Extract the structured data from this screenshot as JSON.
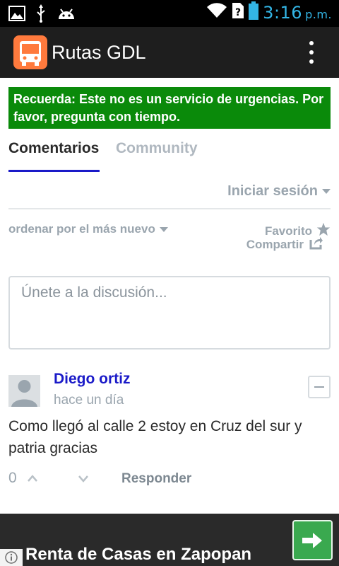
{
  "status_bar": {
    "time": "3:16",
    "ampm": "p.m.",
    "left_icons": [
      "gallery-icon",
      "usb-icon",
      "android-icon"
    ],
    "right_icons": [
      "wifi-icon",
      "sim-unknown-icon",
      "battery-icon"
    ],
    "time_color": "#33b5e5"
  },
  "action_bar": {
    "app_icon": "bus-icon",
    "title": "Rutas GDL",
    "overflow_icon": "overflow-menu-icon"
  },
  "banner": {
    "text": "Recuerda: Este no es un servicio de urgencias. Por favor, pregunta con tiempo.",
    "background": "#0a8a0a"
  },
  "tabs": [
    {
      "label": "Comentarios",
      "active": true
    },
    {
      "label": "Community",
      "active": false
    }
  ],
  "account": {
    "login_label": "Iniciar sesión"
  },
  "toolbar": {
    "sort_label": "ordenar por el más nuevo",
    "favorite_label": "Favorito",
    "share_label": "Compartir"
  },
  "composer": {
    "placeholder": "Únete a la discusión..."
  },
  "comments": [
    {
      "author": "Diego ortiz",
      "time": "hace un día",
      "text": "Como llegó al calle 2 estoy en Cruz del sur y patria gracias",
      "votes": "0",
      "reply_label": "Responder"
    }
  ],
  "ad": {
    "title": "Renta de Casas en Zapopan",
    "arrow_icon": "arrow-right-icon",
    "info_icon": "info-icon"
  },
  "colors": {
    "accent_blue": "#1a1ac8",
    "muted_text": "#9aa5ae",
    "ad_button": "#3aa94f"
  }
}
